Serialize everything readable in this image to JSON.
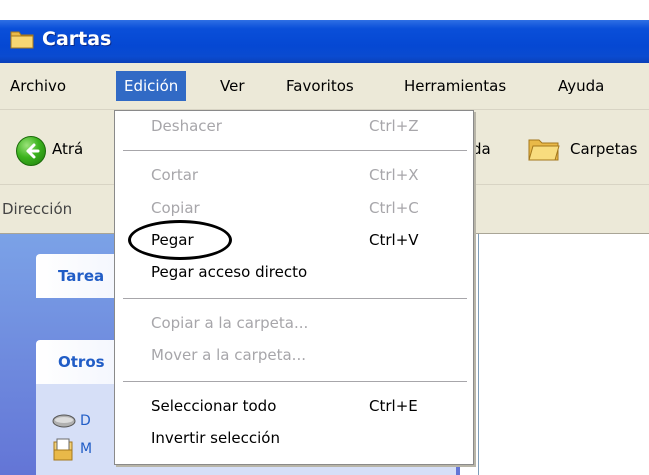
{
  "window": {
    "title": "Cartas"
  },
  "menubar": {
    "items": [
      {
        "label": "Archivo",
        "active": false
      },
      {
        "label": "Edición",
        "active": true
      },
      {
        "label": "Ver",
        "active": false
      },
      {
        "label": "Favoritos",
        "active": false
      },
      {
        "label": "Herramientas",
        "active": false
      },
      {
        "label": "Ayuda",
        "active": false
      }
    ]
  },
  "toolbar": {
    "back_label_partial": "Atrá",
    "forward_label_partial": "da",
    "folders_label": "Carpetas"
  },
  "address": {
    "label": "Dirección"
  },
  "taskpane": {
    "panel1_partial": "Tarea",
    "panel2_partial": "Otros",
    "item1_partial": "D",
    "item2_partial": "M"
  },
  "edit_menu": {
    "undo": {
      "label": "Deshacer",
      "shortcut": "Ctrl+Z",
      "enabled": false
    },
    "cut": {
      "label": "Cortar",
      "shortcut": "Ctrl+X",
      "enabled": false
    },
    "copy": {
      "label": "Copiar",
      "shortcut": "Ctrl+C",
      "enabled": false
    },
    "paste": {
      "label": "Pegar",
      "shortcut": "Ctrl+V",
      "enabled": true
    },
    "paste_shortcut": {
      "label": "Pegar acceso directo",
      "enabled": true
    },
    "copy_to_folder": {
      "label": "Copiar a la carpeta...",
      "enabled": false
    },
    "move_to_folder": {
      "label": "Mover a la carpeta...",
      "enabled": false
    },
    "select_all": {
      "label": "Seleccionar todo",
      "shortcut": "Ctrl+E",
      "enabled": true
    },
    "invert_selection": {
      "label": "Invertir selección",
      "enabled": true
    }
  },
  "colors": {
    "titlebar": "#0548d3",
    "menu_highlight": "#316ac5",
    "menu_bg": "#ece9d8",
    "disabled_text": "#a7a6aa",
    "taskpane_bg": "#6375d6"
  },
  "icons": {
    "title": "folder-icon",
    "back": "back-arrow-icon",
    "folders": "folders-icon",
    "drive": "drive-icon",
    "document": "document-icon"
  }
}
